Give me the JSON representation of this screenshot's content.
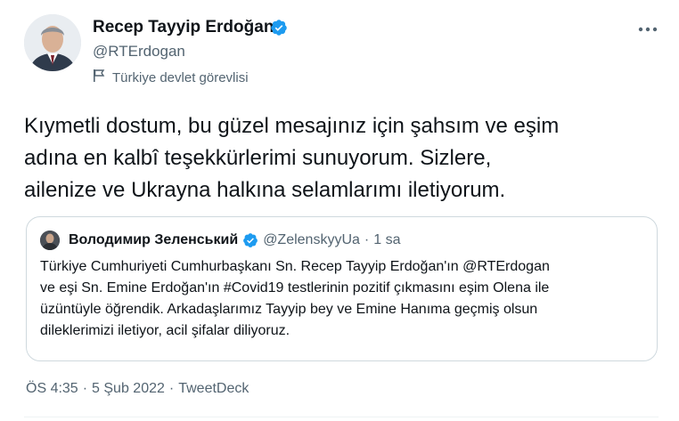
{
  "author": {
    "name": "Recep Tayyip Erdoğan",
    "handle": "@RTErdogan",
    "affiliation_label": "Türkiye devlet görevlisi"
  },
  "tweet": {
    "text_lines": [
      "Kıymetli dostum, bu güzel mesajınız için şahsım ve eşim",
      "adına en kalbî teşekkürlerimi sunuyorum. Sizlere,",
      "ailenize ve Ukrayna halkına selamlarımı iletiyorum."
    ]
  },
  "quoted_tweet": {
    "name": "Володимир Зеленський",
    "handle": "@ZelenskyyUa",
    "separator": "·",
    "time": "1 sa",
    "text_lines": [
      "Türkiye Cumhuriyeti Cumhurbaşkanı Sn. Recep Tayyip Erdoğan'ın @RTErdogan",
      "ve eşi Sn. Emine Erdoğan'ın #Covid19 testlerinin pozitif çıkmasını eşim Olena ile",
      "üzüntüyle öğrendik. Arkadaşlarımız Tayyip bey ve Emine Hanıma geçmiş olsun",
      "dileklerimizi iletiyor, acil şifalar diliyoruz."
    ]
  },
  "meta": {
    "time": "ÖS 4:35",
    "separator": "·",
    "date": "5 Şub 2022",
    "source": "TweetDeck"
  },
  "icons": {
    "verified": "verified-badge-icon",
    "more": "more-options-icon",
    "affiliation": "flag-icon"
  },
  "colors": {
    "verified_blue": "#1d9bf0",
    "secondary_text": "#536471",
    "primary_text": "#0f1419",
    "border": "#cfd9de"
  }
}
